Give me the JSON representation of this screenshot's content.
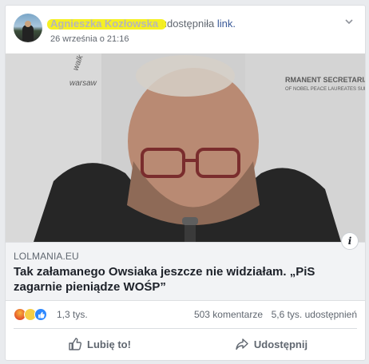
{
  "post": {
    "author": "Agnieszka Kozłowska",
    "verb": "udostępniła",
    "link_word": "link.",
    "timestamp": "26 września o 21:16"
  },
  "icons": {
    "options": "chevron-down-icon",
    "info": "info-icon",
    "like": "thumbs-up-icon",
    "share": "share-arrow-icon"
  },
  "link_preview": {
    "info_glyph": "i",
    "source": "LOLMANIA.EU",
    "headline": "Tak załamanego Owsiaka jeszcze nie widziałam. „PiS zagarnie pieniądze WOŚP”"
  },
  "stats": {
    "reactions_count": "1,3 tys.",
    "comments": "503 komentarze",
    "shares": "5,6 tys. udostępnień"
  },
  "actions": {
    "like_label": "Lubię to!",
    "share_label": "Udostępnij"
  },
  "colors": {
    "link_blue": "#385898",
    "highlight_yellow": "#f5ef1d",
    "secondary_text": "#606770"
  }
}
